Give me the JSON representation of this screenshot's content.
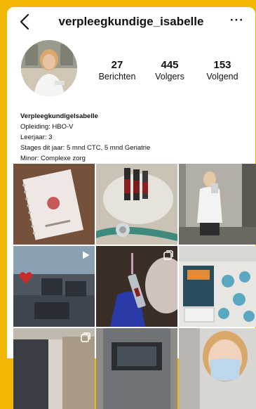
{
  "header": {
    "username": "verpleegkundige_isabelle",
    "more_label": "···"
  },
  "stats": [
    {
      "value": "27",
      "label": "Berichten"
    },
    {
      "value": "445",
      "label": "Volgers"
    },
    {
      "value": "153",
      "label": "Volgend"
    }
  ],
  "bio": {
    "name": "VerpleegkundigeIsabelle",
    "lines": [
      "Opleiding: HBO-V",
      "Leerjaar: 3",
      "Stages dit jaar: 5 mnd CTC, 5 mnd Geriatrie",
      "Minor: Complexe zorg"
    ]
  },
  "icons": {
    "back": "chevron-left-icon",
    "more": "more-icon",
    "video": "video-play-icon",
    "multi": "multiple-posts-icon"
  },
  "posts": [
    {
      "subject": "notebook with heart",
      "badge": ""
    },
    {
      "subject": "blood tubes on table",
      "badge": ""
    },
    {
      "subject": "mirror selfie in uniform",
      "badge": ""
    },
    {
      "subject": "hospital ward",
      "badge": "video"
    },
    {
      "subject": "blue glove with blood sample",
      "badge": "multi"
    },
    {
      "subject": "books and cards",
      "badge": ""
    },
    {
      "subject": "hallway",
      "badge": "multi"
    },
    {
      "subject": "laptop",
      "badge": ""
    },
    {
      "subject": "selfie with face mask",
      "badge": ""
    }
  ]
}
